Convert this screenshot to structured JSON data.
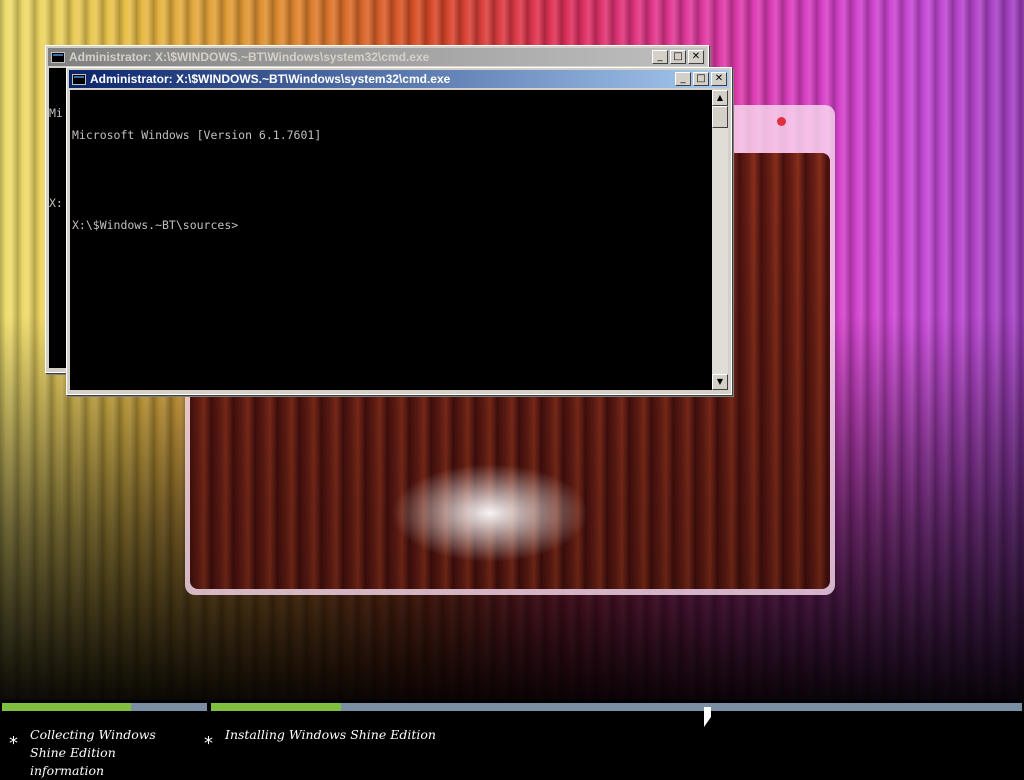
{
  "windows": {
    "background": {
      "title": "Administrator: X:\\$WINDOWS.~BT\\Windows\\system32\\cmd.exe",
      "console_lines": [
        "Mi",
        "",
        "X:"
      ]
    },
    "foreground": {
      "title": "Administrator: X:\\$WINDOWS.~BT\\Windows\\system32\\cmd.exe",
      "console_lines": [
        "Microsoft Windows [Version 6.1.7601]",
        "",
        "X:\\$Windows.~BT\\sources>"
      ]
    },
    "buttons": {
      "minimize": "_",
      "maximize": "□",
      "close": "✕"
    },
    "scroll": {
      "up": "▲",
      "down": "▼"
    }
  },
  "setup": {
    "steps": [
      {
        "bullet": "*",
        "label": "Collecting Windows Shine Edition information"
      },
      {
        "bullet": "*",
        "label": "Installing Windows Shine Edition"
      }
    ],
    "progress": [
      0.63,
      0.16
    ],
    "colors": {
      "fill": "#80c040",
      "track": "#7a8ea4"
    }
  },
  "icons": [
    "console-icon",
    "minimize-icon",
    "maximize-icon",
    "close-icon",
    "scroll-up-icon",
    "scroll-down-icon",
    "mouse-cursor-icon"
  ]
}
